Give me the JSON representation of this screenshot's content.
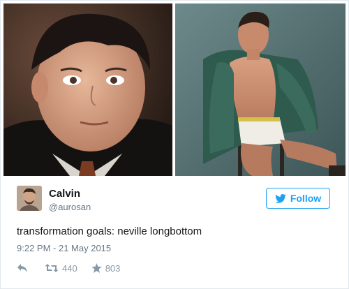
{
  "photos": {
    "left_icon": "photo-neville-young",
    "right_icon": "photo-neville-adult"
  },
  "tweet": {
    "avatar_icon": "user-avatar",
    "name": "Calvin",
    "handle": "@aurosan",
    "follow_label": "Follow",
    "follow_icon": "twitter-bird-icon",
    "text": "transformation goals: neville longbottom",
    "timestamp": "9:22 PM - 21 May 2015",
    "actions": {
      "reply_icon": "reply-icon",
      "retweet_icon": "retweet-icon",
      "retweet_count": "440",
      "like_icon": "star-icon",
      "like_count": "803"
    }
  },
  "colors": {
    "brand": "#1da1f2",
    "text": "#14171a",
    "muted": "#657786",
    "action": "#8899a6"
  }
}
